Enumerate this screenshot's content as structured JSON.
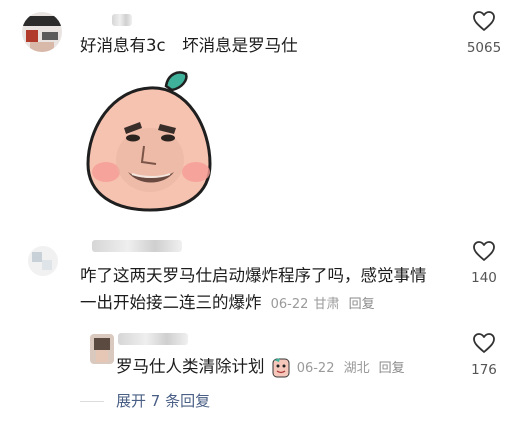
{
  "comments": [
    {
      "text": "好消息有3c　坏消息是罗马仕",
      "likes": "5065"
    },
    {
      "text_line1": "咋了这两天罗马仕启动爆炸程序了吗，感觉事情",
      "text_line2": "一出开始接二连三的爆炸",
      "date": "06-22",
      "location": "甘肃",
      "reply_label": "回复",
      "likes": "140"
    }
  ],
  "reply": {
    "text": "罗马仕人类清除计划",
    "date": "06-22",
    "location": "湖北",
    "reply_label": "回复",
    "likes": "176"
  },
  "expand_label": "展开 7 条回复",
  "icons": {
    "like": "heart-outline-icon",
    "sticker": "peach-face-sticker",
    "inline_emoji": "face-emoji-icon"
  },
  "colors": {
    "accent_link": "#4a5f86",
    "meta_gray": "#9a9a9a",
    "sticker_leaf": "#3fb19a",
    "sticker_peach": "#f6b7a4"
  }
}
